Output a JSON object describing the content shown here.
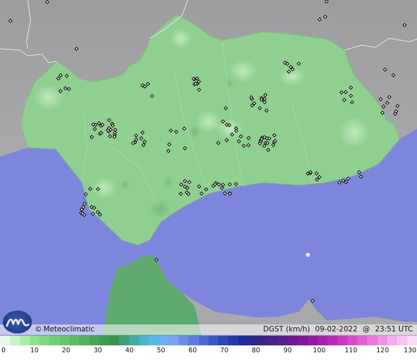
{
  "map": {
    "region": "Andalucía",
    "sea_color": "#7d86dc",
    "land_color": "#8fd090",
    "outside_land_color": "#a9a9ab",
    "station_count": 180
  },
  "footer": {
    "attribution": "Meteoclimatic",
    "copyright_symbol": "©",
    "variable": "DGST (km/h)",
    "date": "09-02-2022",
    "at": "@",
    "time": "23:51 UTC"
  },
  "legend": {
    "colors": [
      "#e8fbe8",
      "#c8f3c8",
      "#a9ebaa",
      "#8fe390",
      "#7cd97e",
      "#6fcf76",
      "#66c56f",
      "#5bbb68",
      "#52b05f",
      "#49a657",
      "#409c52",
      "#3a9350",
      "#3f9e79",
      "#44aa9f",
      "#4ab4c8",
      "#54b9e6",
      "#6bb0ef",
      "#7aa4f0",
      "#6e8fe6",
      "#5e7cdc",
      "#4f69d1",
      "#3f56c6",
      "#3144b8",
      "#2637a7",
      "#1d2c96",
      "#2c2886",
      "#3a2582",
      "#4c2388",
      "#5c1f8e",
      "#6d1b94",
      "#7e179a",
      "#901ca3",
      "#a523ae",
      "#b92bb8",
      "#cb39c2",
      "#d84ccc",
      "#e261d5",
      "#e979de",
      "#ef92e6",
      "#f3aced",
      "#f6c4f2",
      "#f9daf7"
    ],
    "ticks": [
      "0",
      "10",
      "20",
      "30",
      "40",
      "50",
      "60",
      "70",
      "80",
      "90",
      "100",
      "110",
      "120",
      "130"
    ]
  },
  "logo": {
    "name": "meteoclimatic-logo"
  }
}
